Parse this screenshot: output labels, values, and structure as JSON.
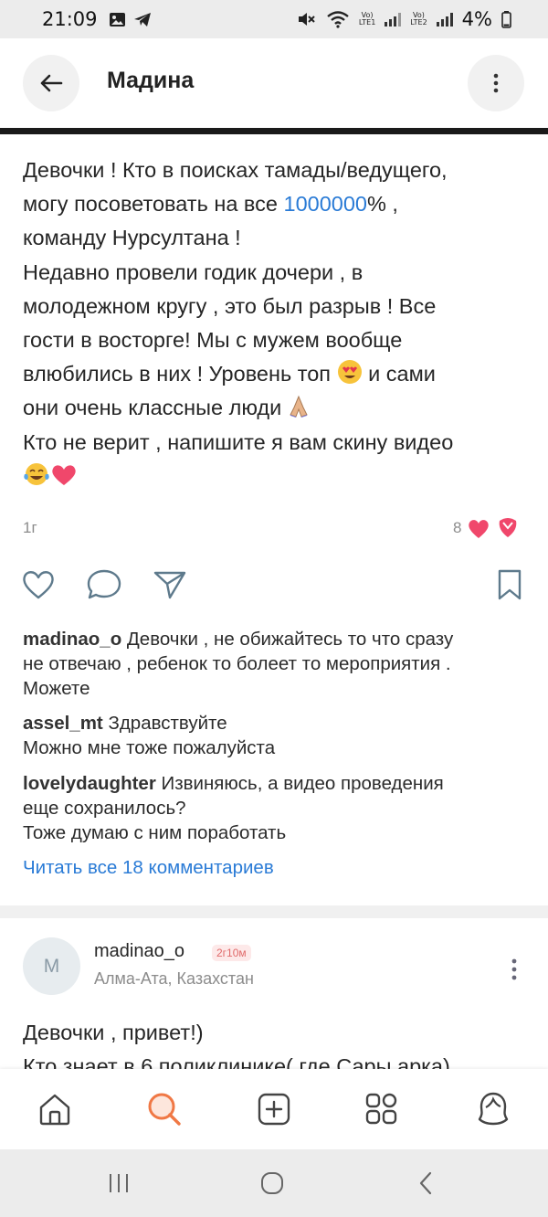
{
  "status": {
    "time": "21:09",
    "battery": "4%"
  },
  "header": {
    "title": "Мадина"
  },
  "post": {
    "line1": "Девочки ! Кто в поисках тамады/ведущего,",
    "line2_pre": "могу посоветовать на все ",
    "line2_link": "1000000",
    "line2_post": "% ,",
    "line3": "команду Нурсултана !",
    "line4": "Недавно провели годик дочери , в",
    "line5": "молодежном кругу , это был разрыв ! Все",
    "line6": "гости в восторге! Мы с мужем вообще",
    "line7_pre": "влюбились в них ! Уровень топ ",
    "line7_post": " и сами",
    "line8": "они очень классные люди ",
    "line9": "Кто не верит , напишите я вам скину видео",
    "age": "1г",
    "likes": "8"
  },
  "comments": [
    {
      "user": "madinao_o",
      "text": " Девочки , не обижайтесь то что сразу",
      "line2": "не отвечаю , ребенок то болеет то мероприятия .",
      "line3": "Можете"
    },
    {
      "user": "assel_mt",
      "text": " Здравствуйте",
      "line2": "Можно мне тоже пожалуйста"
    },
    {
      "user": "lovelydaughter",
      "text": " Извиняюсь, а видео проведения",
      "line2": "еще сохранилось?",
      "line3": "Тоже думаю с ним поработать"
    }
  ],
  "read_all": "Читать все 18 комментариев",
  "post2": {
    "avatar_letter": "M",
    "author": "madinao_o",
    "time_badge": "2г10м",
    "location": "Алма-Ата, Казахстан",
    "line1": "Девочки , привет!)",
    "line2": "Кто знает в 6 поликлинике( где Сары арка)"
  },
  "icons": {
    "back": "arrow-left-icon",
    "more": "more-vertical-icon",
    "like": "heart-icon",
    "comment": "comment-bubble-icon",
    "share": "send-icon",
    "save": "bookmark-icon",
    "tab_home": "home-icon",
    "tab_search": "search-icon",
    "tab_add": "add-post-icon",
    "tab_services": "services-grid-icon",
    "tab_profile": "profile-icon"
  },
  "colors": {
    "link": "#2a7bd6",
    "accent": "#f07845",
    "like": "#f0476b"
  }
}
